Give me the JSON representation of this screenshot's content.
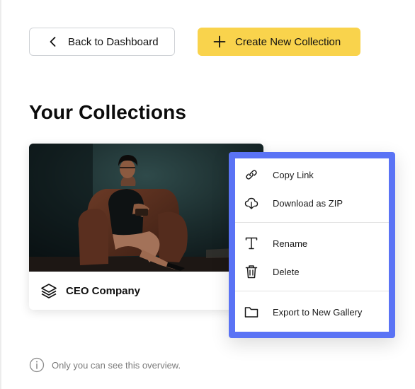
{
  "toolbar": {
    "back_label": "Back to Dashboard",
    "create_label": "Create New Collection",
    "create_color": "#f9d34c"
  },
  "page": {
    "title": "Your Collections"
  },
  "collections": [
    {
      "name": "CEO Company",
      "icon": "layers-icon",
      "cover": "photo-of-woman-in-leather-armchair"
    }
  ],
  "context_menu": {
    "frame_color": "#5a73f5",
    "groups": [
      [
        {
          "label": "Copy Link",
          "icon": "link-icon"
        },
        {
          "label": "Download as ZIP",
          "icon": "cloud-download-icon"
        }
      ],
      [
        {
          "label": "Rename",
          "icon": "text-icon"
        },
        {
          "label": "Delete",
          "icon": "trash-icon"
        }
      ],
      [
        {
          "label": "Export to New Gallery",
          "icon": "folder-icon"
        }
      ]
    ]
  },
  "footer_note": {
    "text": "Only you can see this overview.",
    "icon": "info-icon"
  }
}
